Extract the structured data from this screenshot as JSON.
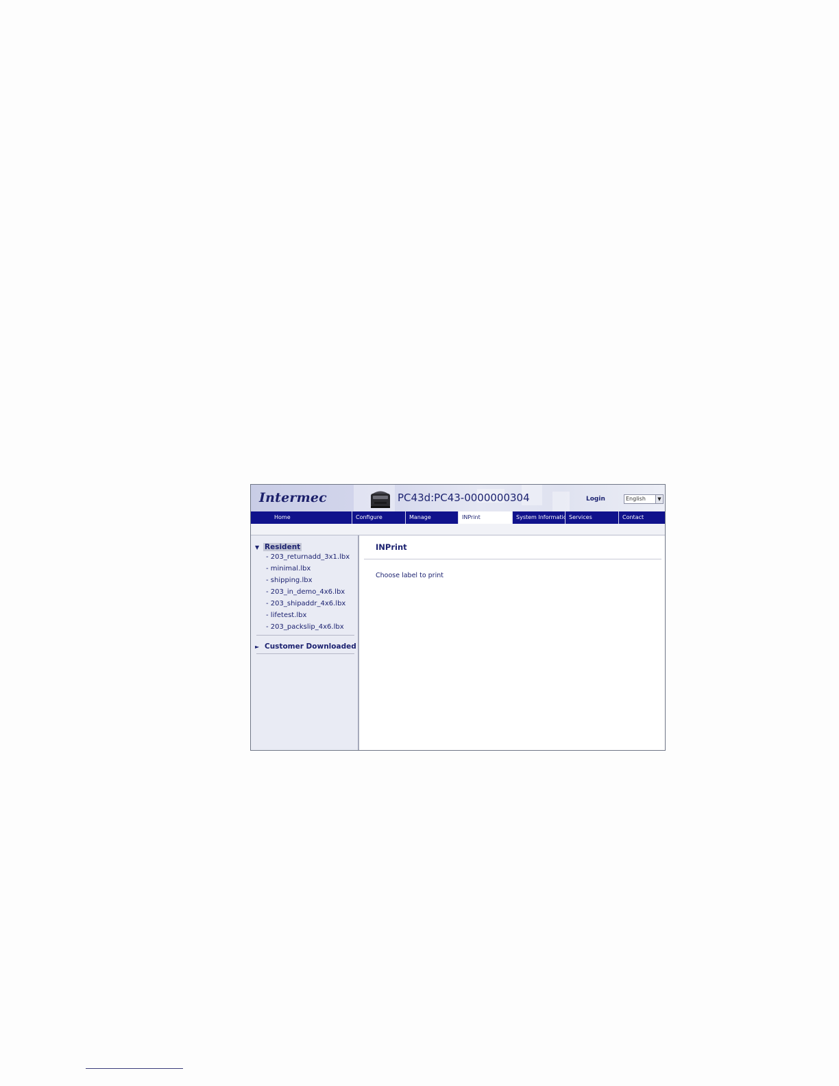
{
  "header": {
    "logo": "Intermec",
    "device_title": "PC43d:PC43-0000000304",
    "login_label": "Login",
    "language_selected": "English"
  },
  "nav": {
    "tabs": [
      {
        "label": "Home",
        "active": false
      },
      {
        "label": "Configure",
        "active": false
      },
      {
        "label": "Manage",
        "active": false
      },
      {
        "label": "INPrint",
        "active": true
      },
      {
        "label": "System Informatio",
        "active": false
      },
      {
        "label": "Services",
        "active": false
      },
      {
        "label": "Contact",
        "active": false
      }
    ]
  },
  "sidebar": {
    "resident": {
      "label": "Resident",
      "expanded_marker": "▼",
      "items": [
        "- 203_returnadd_3x1.lbx",
        "- minimal.lbx",
        "- shipping.lbx",
        "- 203_in_demo_4x6.lbx",
        "- 203_shipaddr_4x6.lbx",
        "- lifetest.lbx",
        "- 203_packslip_4x6.lbx"
      ]
    },
    "customer": {
      "label": "Customer Downloaded",
      "collapsed_marker": "►"
    }
  },
  "main": {
    "title": "INPrint",
    "instruction": "Choose label to print"
  },
  "colors": {
    "nav_bg": "#10128c",
    "text_navy": "#1c2270",
    "sidebar_bg": "#e9ebf4"
  }
}
